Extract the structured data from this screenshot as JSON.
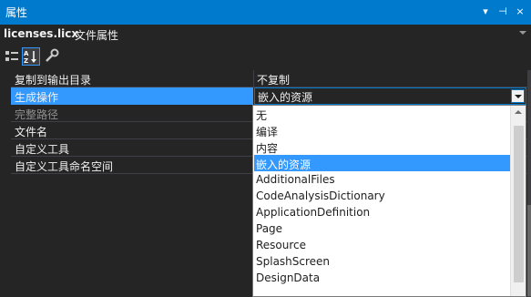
{
  "window": {
    "title": "属性",
    "controls": {
      "dropdown": "▾",
      "pin": "⊣",
      "close": "×"
    }
  },
  "object": {
    "name": "licenses.licx",
    "type": "文件属性"
  },
  "toolbar": {
    "buttons": [
      {
        "icon": "categorized-icon",
        "active": false
      },
      {
        "icon": "alphabetical-sort-icon",
        "active": true
      },
      {
        "icon": "wrench-icon",
        "active": false
      }
    ]
  },
  "properties": [
    {
      "name": "复制到输出目录",
      "value": "不复制",
      "disabled": false
    },
    {
      "name": "生成操作",
      "value": "嵌入的资源",
      "selected": true
    },
    {
      "name": "完整路径",
      "value": "",
      "disabled": true
    },
    {
      "name": "文件名",
      "value": "",
      "disabled": false
    },
    {
      "name": "自定义工具",
      "value": "",
      "disabled": false
    },
    {
      "name": "自定义工具命名空间",
      "value": "",
      "disabled": false
    }
  ],
  "dropdown": {
    "current": "嵌入的资源",
    "options": [
      "无",
      "编译",
      "内容",
      "嵌入的资源",
      "AdditionalFiles",
      "CodeAnalysisDictionary",
      "ApplicationDefinition",
      "Page",
      "Resource",
      "SplashScreen",
      "DesignData"
    ],
    "selected_index": 3
  },
  "colors": {
    "accent": "#007acc",
    "selection": "#3399ff",
    "background": "#252526"
  }
}
